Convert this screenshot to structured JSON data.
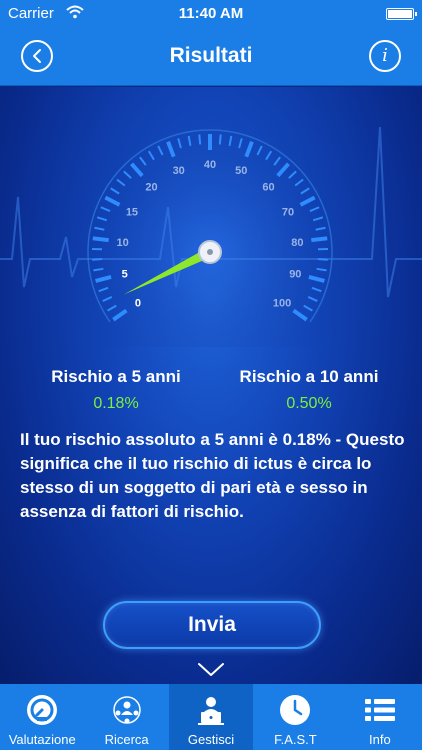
{
  "status_bar": {
    "carrier": "Carrier",
    "time": "11:40 AM",
    "wifi_icon": "wifi-icon",
    "battery_icon": "battery-icon"
  },
  "nav": {
    "title": "Risultati",
    "back_icon": "chevron-left-circle-icon",
    "info_icon": "info-circle-icon",
    "info_glyph": "i"
  },
  "gauge": {
    "scale_labels": [
      "0",
      "5",
      "10",
      "15",
      "20",
      "30",
      "40",
      "50",
      "60",
      "70",
      "80",
      "90",
      "100"
    ],
    "needle_value": 0.18,
    "needle_color": "#8ee82a",
    "tick_color": "#2e8cff"
  },
  "risk": {
    "five_year_label": "Rischio a 5 anni",
    "five_year_value": "0.18%",
    "ten_year_label": "Rischio a 10 anni",
    "ten_year_value": "0.50%",
    "value_color": "#7cf03c"
  },
  "explanation": "Il tuo rischio assoluto a 5 anni è  0.18% - Questo significa che il tuo rischio di ictus è circa lo stesso di un soggetto di pari età e sesso in assenza di fattori di rischio.",
  "send_button_label": "Invia",
  "tabs": [
    {
      "label": "Valutazione",
      "icon": "gauge-icon",
      "active": false
    },
    {
      "label": "Ricerca",
      "icon": "people-network-icon",
      "active": false
    },
    {
      "label": "Gestisci",
      "icon": "user-laptop-icon",
      "active": true
    },
    {
      "label": "F.A.S.T",
      "icon": "clock-icon",
      "active": false
    },
    {
      "label": "Info",
      "icon": "list-icon",
      "active": false
    }
  ],
  "colors": {
    "bar_blue": "#1a7ee6",
    "accent_green": "#7cf03c"
  }
}
